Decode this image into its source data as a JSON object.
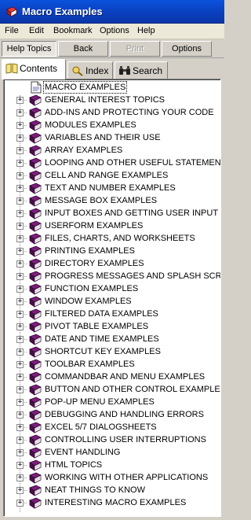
{
  "window": {
    "title": "Macro Examples",
    "icon": "help-book-icon",
    "titlebar_color": "#0a46c8"
  },
  "menubar": {
    "items": [
      "File",
      "Edit",
      "Bookmark",
      "Options",
      "Help"
    ]
  },
  "toolbar": {
    "help_topics": "Help Topics",
    "back": "Back",
    "print": "Print",
    "options": "Options"
  },
  "tabs": [
    {
      "label": "Contents",
      "icon": "book-icon",
      "active": true
    },
    {
      "label": "Index",
      "icon": "index-icon",
      "active": false
    },
    {
      "label": "Search",
      "icon": "binoculars-icon",
      "active": false
    }
  ],
  "tree": {
    "root": "MACRO EXAMPLES",
    "items": [
      "GENERAL INTEREST TOPICS",
      "ADD-INS AND PROTECTING YOUR CODE",
      "MODULES EXAMPLES",
      "VARIABLES AND THEIR USE",
      "ARRAY EXAMPLES",
      "LOOPING AND OTHER USEFUL STATEMENTS",
      "CELL AND RANGE EXAMPLES",
      "TEXT AND NUMBER EXAMPLES",
      "MESSAGE BOX EXAMPLES",
      "INPUT BOXES AND GETTING USER INPUT",
      "USERFORM EXAMPLES",
      "FILES, CHARTS, AND WORKSHEETS",
      "PRINTING EXAMPLES",
      "DIRECTORY EXAMPLES",
      "PROGRESS MESSAGES AND SPLASH SCREENS",
      "FUNCTION EXAMPLES",
      "WINDOW EXAMPLES",
      "FILTERED DATA EXAMPLES",
      "PIVOT TABLE EXAMPLES",
      "DATE AND TIME EXAMPLES",
      "SHORTCUT KEY EXAMPLES",
      "TOOLBAR EXAMPLES",
      "COMMANDBAR AND MENU EXAMPLES",
      "BUTTON AND OTHER CONTROL EXAMPLES",
      "POP-UP MENU EXAMPLES",
      "DEBUGGING AND HANDLING ERRORS",
      "EXCEL 5/7 DIALOGSHEETS",
      "CONTROLLING USER INTERRUPTIONS",
      "EVENT HANDLING",
      "HTML TOPICS",
      "WORKING WITH OTHER APPLICATIONS",
      "NEAT THINGS TO KNOW",
      "INTERESTING MACRO EXAMPLES"
    ],
    "item_icon": "closed-book-icon",
    "book_color": "#7a1f7a"
  }
}
